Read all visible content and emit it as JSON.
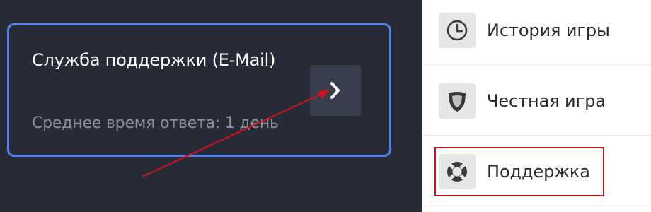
{
  "support_card": {
    "title": "Служба поддержки (E-Mail)",
    "subtitle": "Среднее время ответа: 1 день",
    "open_icon": "chevron-right-icon"
  },
  "menu": {
    "items": [
      {
        "label": "История игры",
        "icon": "clock-icon"
      },
      {
        "label": "Честная игра",
        "icon": "shield-icon"
      },
      {
        "label": "Поддержка",
        "icon": "lifebuoy-icon",
        "highlighted": true
      }
    ]
  },
  "colors": {
    "background_dark": "#262b37",
    "card_border": "#4f83e8",
    "annotation_red": "#d4111b",
    "menu_background": "#ffffff"
  }
}
